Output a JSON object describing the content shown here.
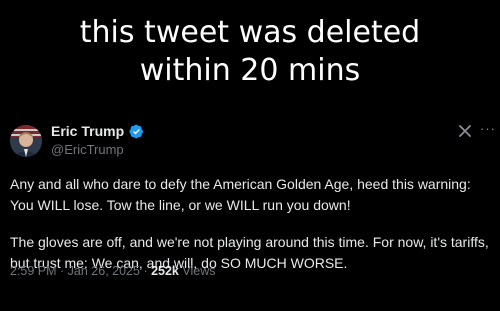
{
  "caption": {
    "line1": "this tweet was deleted",
    "line2": "within 20 mins"
  },
  "tweet": {
    "author_name": "Eric Trump",
    "handle": "@EricTrump",
    "grok_icon": "grok-icon",
    "more_label": "···",
    "paragraph1": "Any and all who dare to defy the American Golden Age, heed this warning: You WILL lose. Tow the line, or we WILL run you down!",
    "paragraph2": "The gloves are off, and we're not playing around this time. For now, it's tariffs, but trust me: We can, and will, do SO MUCH WORSE.",
    "time": "2:59 PM",
    "date": "Jan 26, 2025",
    "views_count": "252k",
    "views_label": "Views",
    "separator": " · ",
    "colors": {
      "verified_badge": "#1d9bf0",
      "secondary_text": "#71767b",
      "primary_text": "#e7e9ea"
    }
  }
}
